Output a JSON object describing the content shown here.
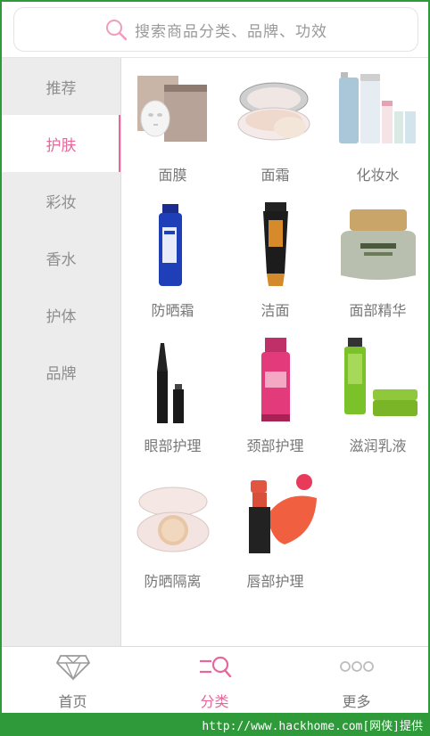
{
  "search": {
    "placeholder": "搜索商品分类、品牌、功效"
  },
  "sidebar": {
    "items": [
      {
        "label": "推荐"
      },
      {
        "label": "护肤"
      },
      {
        "label": "彩妆"
      },
      {
        "label": "香水"
      },
      {
        "label": "护体"
      },
      {
        "label": "品牌"
      }
    ],
    "active_index": 1
  },
  "grid": {
    "items": [
      {
        "label": "面膜",
        "icon": "face-mask-icon"
      },
      {
        "label": "面霜",
        "icon": "face-cream-icon"
      },
      {
        "label": "化妆水",
        "icon": "toner-icon"
      },
      {
        "label": "防晒霜",
        "icon": "sunscreen-icon"
      },
      {
        "label": "洁面",
        "icon": "cleanser-icon"
      },
      {
        "label": "面部精华",
        "icon": "essence-icon"
      },
      {
        "label": "眼部护理",
        "icon": "eyeliner-icon"
      },
      {
        "label": "颈部护理",
        "icon": "neck-care-icon"
      },
      {
        "label": "滋润乳液",
        "icon": "lotion-icon"
      },
      {
        "label": "防晒隔离",
        "icon": "cushion-icon"
      },
      {
        "label": "唇部护理",
        "icon": "lipstick-icon"
      }
    ]
  },
  "nav": {
    "tabs": [
      {
        "label": "首页",
        "icon": "diamond-icon"
      },
      {
        "label": "分类",
        "icon": "category-search-icon"
      },
      {
        "label": "更多",
        "icon": "more-dots-icon"
      }
    ],
    "active_index": 1
  },
  "watermark": {
    "text": "http://www.hackhome.com[网侠]提供"
  },
  "colors": {
    "accent": "#e8679a",
    "sidebar_bg": "#ececec",
    "frame": "#2e9a3a"
  }
}
